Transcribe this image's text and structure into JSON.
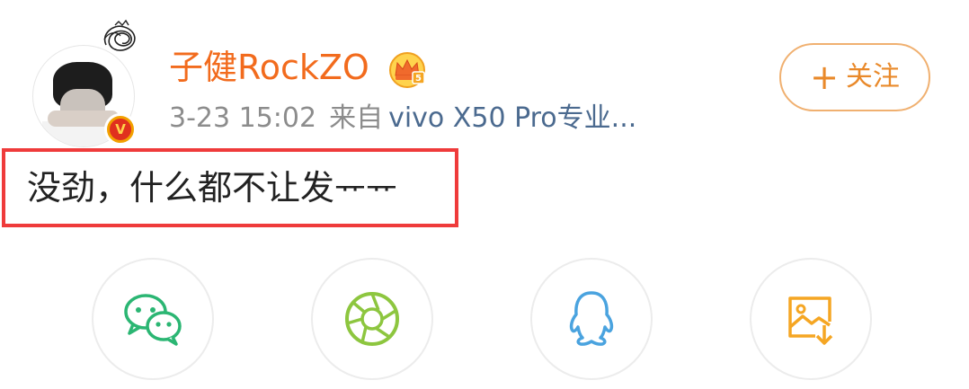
{
  "post": {
    "username": "子健RockZO",
    "time": "3-23 15:02",
    "from_label": "来自",
    "device": "vivo X50 Pro专业...",
    "text": "没劲，什么都不让发ᅲᅲ",
    "follow": {
      "plus": "+",
      "label": "关注"
    }
  },
  "avatar": {
    "badge_letter": "V"
  },
  "icons": {
    "crown": "crown-vip-icon",
    "verified": "verified-v-icon",
    "scribble": "scribble-icon"
  },
  "share_buttons": [
    {
      "name": "wechat-icon",
      "color": "#2bb673"
    },
    {
      "name": "moments-icon",
      "color": "#8dc63f"
    },
    {
      "name": "qq-icon",
      "color": "#4aa3df"
    },
    {
      "name": "save-image-icon",
      "color": "#f5a623"
    }
  ],
  "colors": {
    "username": "#f26b1d",
    "device_link": "#4b6a8f",
    "follow": "#e9892a",
    "highlight_box": "#ef3b3b"
  }
}
